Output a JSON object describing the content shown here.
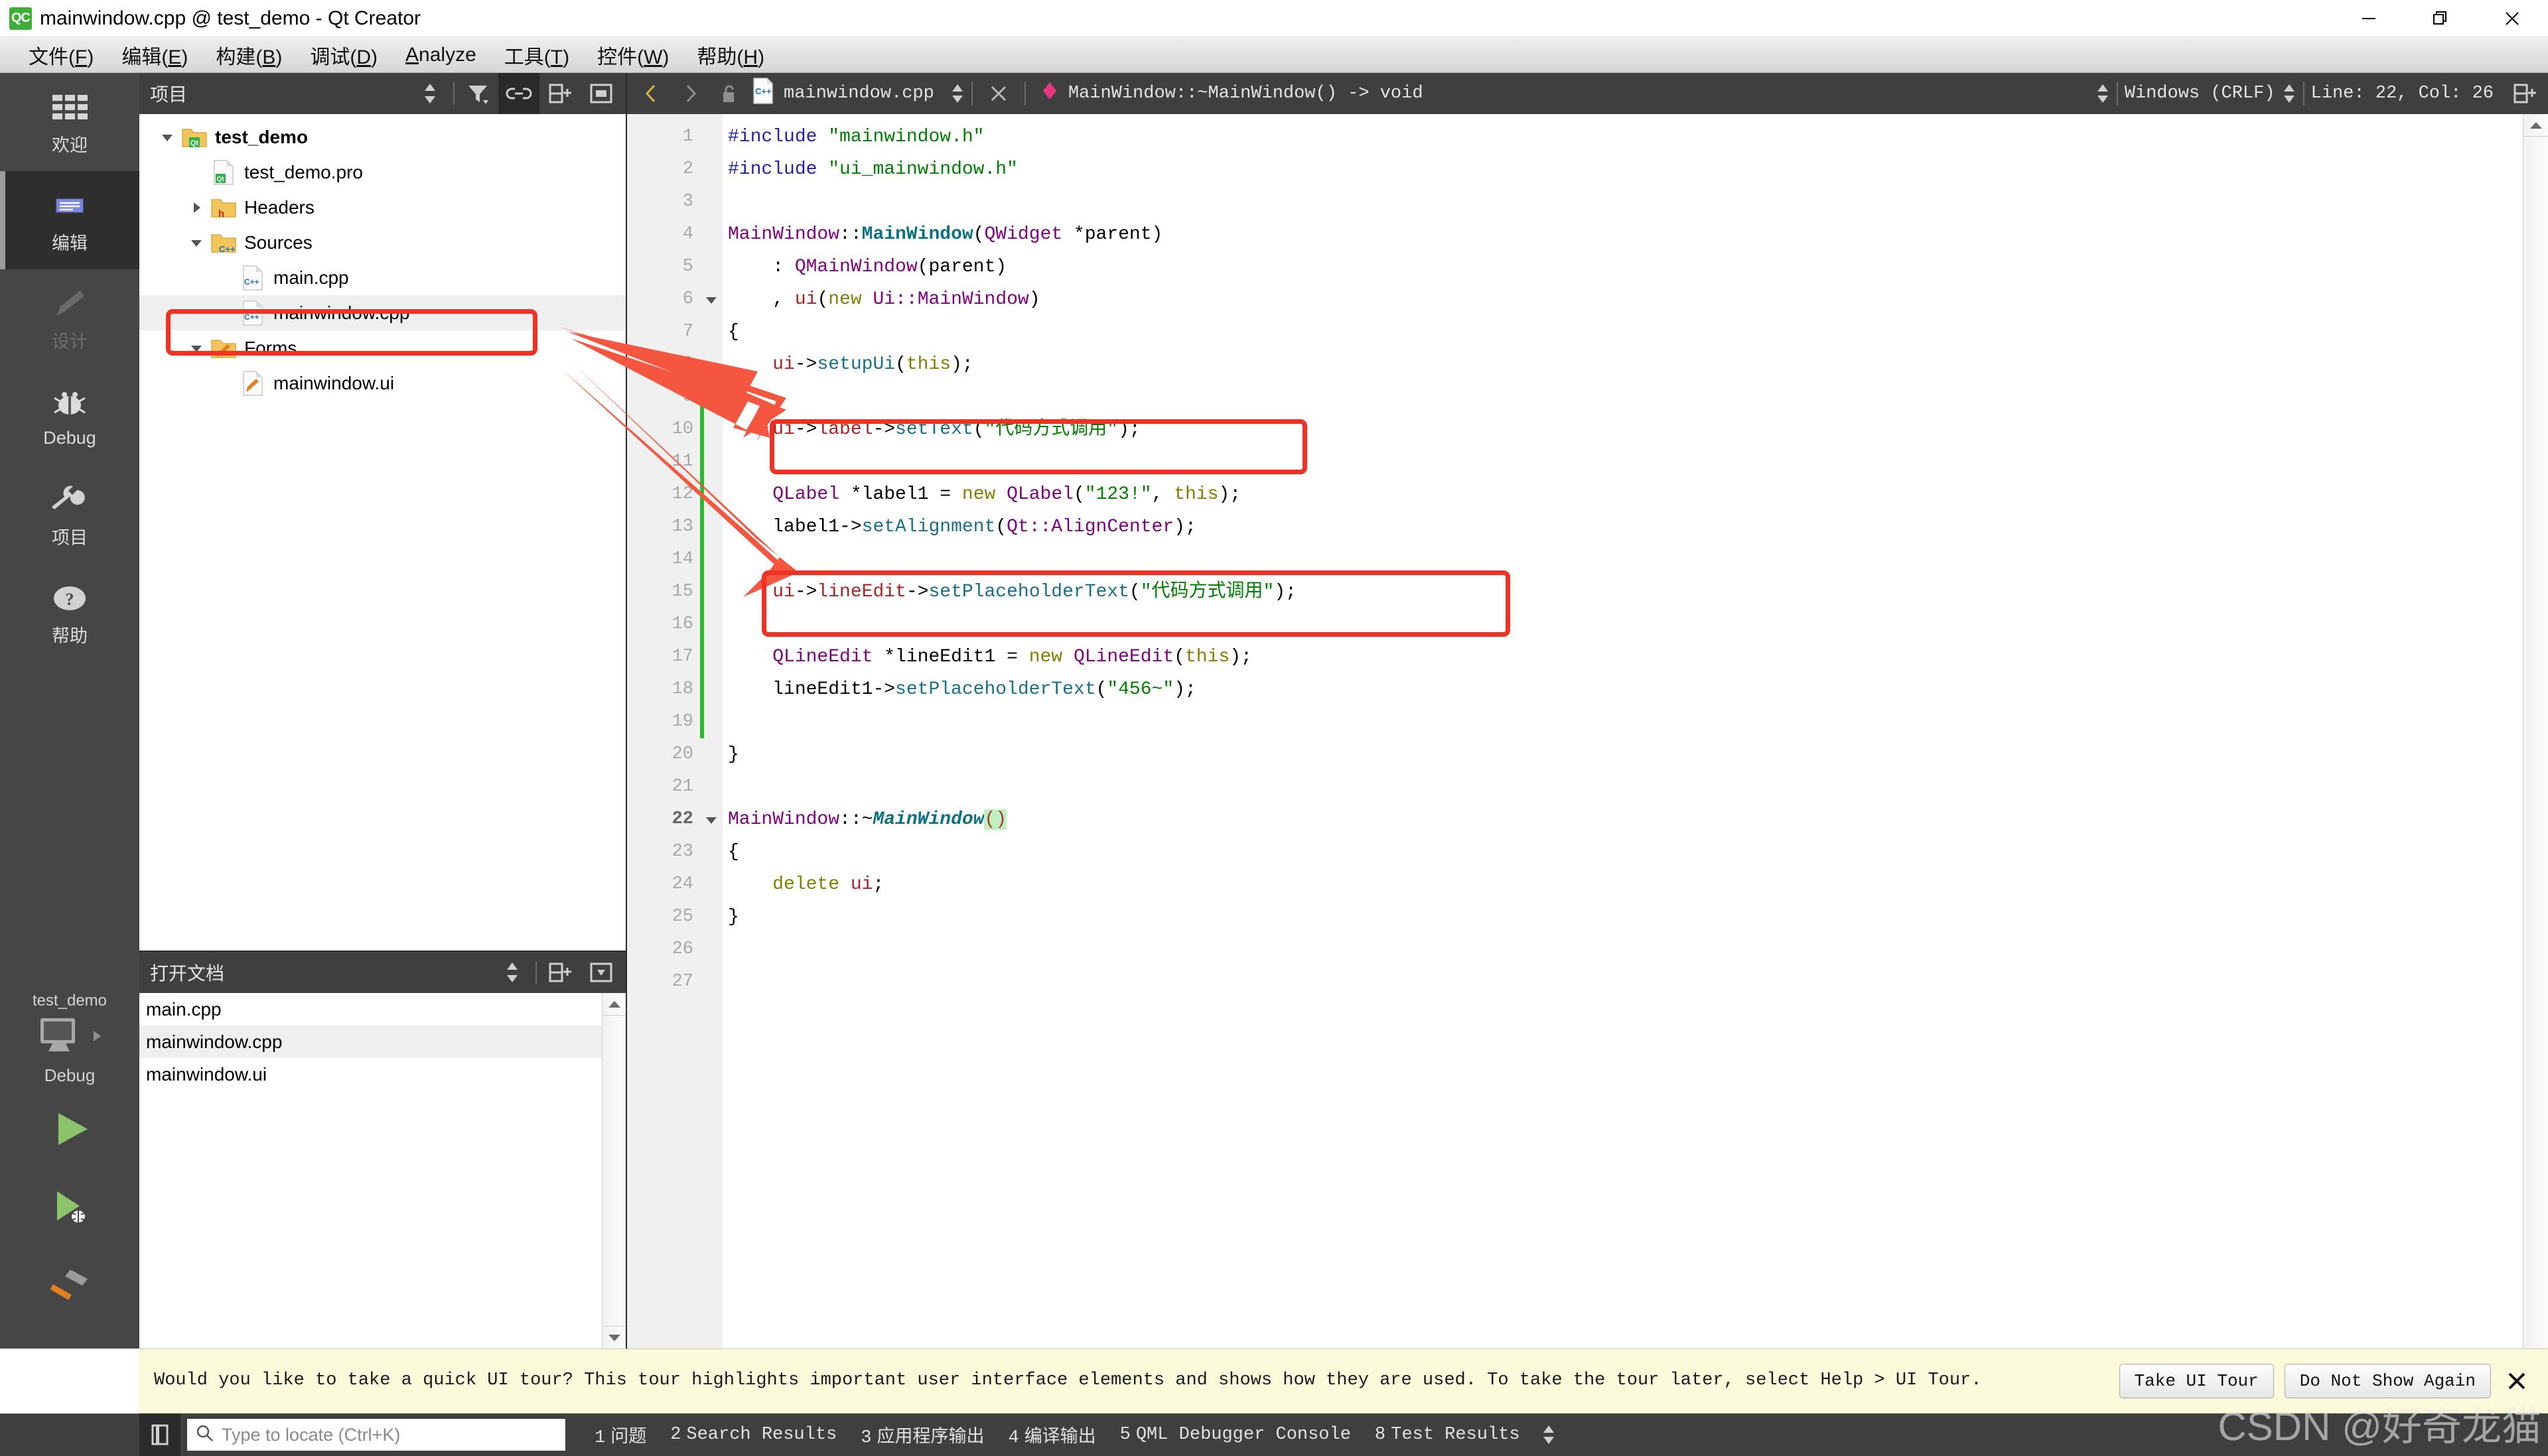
{
  "window": {
    "title": "mainwindow.cpp @ test_demo - Qt Creator",
    "logo_text": "QC",
    "minimize_label": "—",
    "maximize_label": "❐",
    "close_label": "✕"
  },
  "menubar": {
    "items": [
      {
        "name": "file",
        "pre": "文件(",
        "key": "F",
        "post": ")"
      },
      {
        "name": "edit",
        "pre": "编辑(",
        "key": "E",
        "post": ")"
      },
      {
        "name": "build",
        "pre": "构建(",
        "key": "B",
        "post": ")"
      },
      {
        "name": "debug",
        "pre": "调试(",
        "key": "D",
        "post": ")"
      },
      {
        "name": "analyze",
        "pre": "",
        "key": "A",
        "post": "nalyze"
      },
      {
        "name": "tools",
        "pre": "工具(",
        "key": "T",
        "post": ")"
      },
      {
        "name": "widgets",
        "pre": "控件(",
        "key": "W",
        "post": ")"
      },
      {
        "name": "help",
        "pre": "帮助(",
        "key": "H",
        "post": ")"
      }
    ]
  },
  "modebar": {
    "modes": [
      {
        "id": "welcome",
        "label": "欢迎",
        "icon": "grid-icon",
        "state": "normal"
      },
      {
        "id": "edit",
        "label": "编辑",
        "icon": "edit-icon",
        "state": "active"
      },
      {
        "id": "design",
        "label": "设计",
        "icon": "pencil-icon",
        "state": "disabled"
      },
      {
        "id": "debug",
        "label": "Debug",
        "icon": "bug-icon",
        "state": "normal"
      },
      {
        "id": "projects",
        "label": "项目",
        "icon": "wrench-icon",
        "state": "normal"
      },
      {
        "id": "help",
        "label": "帮助",
        "icon": "question-icon",
        "state": "normal"
      }
    ],
    "kit": {
      "project": "test_demo",
      "build_config": "Debug",
      "target_icon": "desktop-icon",
      "arrow_icon": "chevron-right-icon"
    },
    "actions": [
      {
        "id": "run",
        "icon": "run-icon"
      },
      {
        "id": "debug-run",
        "icon": "debug-run-icon"
      },
      {
        "id": "build",
        "icon": "hammer-icon"
      }
    ]
  },
  "project_panel": {
    "title": "项目",
    "tools": [
      {
        "id": "sync-selector",
        "icon": "updown-arrows-icon",
        "active": false
      },
      {
        "id": "filter",
        "icon": "filter-icon",
        "active": false
      },
      {
        "id": "link-editor",
        "icon": "link-icon",
        "active": true
      },
      {
        "id": "split",
        "icon": "split-add-icon",
        "active": false
      },
      {
        "id": "close-panel",
        "icon": "panel-close-icon",
        "active": false
      }
    ],
    "tree": [
      {
        "id": "test_demo",
        "label": "test_demo",
        "depth": 0,
        "arrow": "down",
        "icon": "qt-folder-icon",
        "bold": true,
        "selected": false
      },
      {
        "id": "test_demo_pro",
        "label": "test_demo.pro",
        "depth": 1,
        "arrow": "none",
        "icon": "qt-file-icon",
        "bold": false,
        "selected": false
      },
      {
        "id": "headers",
        "label": "Headers",
        "depth": 1,
        "arrow": "right",
        "icon": "h-folder-icon",
        "bold": false,
        "selected": false
      },
      {
        "id": "sources",
        "label": "Sources",
        "depth": 1,
        "arrow": "down",
        "icon": "cpp-folder-icon",
        "bold": false,
        "selected": false
      },
      {
        "id": "main_cpp",
        "label": "main.cpp",
        "depth": 2,
        "arrow": "none",
        "icon": "cpp-file-icon",
        "bold": false,
        "selected": false
      },
      {
        "id": "mainwindow_cpp",
        "label": "mainwindow.cpp",
        "depth": 2,
        "arrow": "none",
        "icon": "cpp-file-icon",
        "bold": false,
        "selected": true
      },
      {
        "id": "forms",
        "label": "Forms",
        "depth": 1,
        "arrow": "down",
        "icon": "ui-folder-icon",
        "bold": false,
        "selected": false
      },
      {
        "id": "mainwindow_ui",
        "label": "mainwindow.ui",
        "depth": 2,
        "arrow": "none",
        "icon": "ui-file-icon",
        "bold": false,
        "selected": false
      }
    ]
  },
  "open_documents": {
    "title": "打开文档",
    "tools": [
      {
        "id": "od-sync",
        "icon": "updown-arrows-icon"
      },
      {
        "id": "od-split",
        "icon": "split-add-icon"
      },
      {
        "id": "od-close",
        "icon": "panel-dropdown-icon"
      }
    ],
    "items": [
      {
        "id": "main_cpp",
        "label": "main.cpp",
        "selected": false
      },
      {
        "id": "mainwindow_cpp",
        "label": "mainwindow.cpp",
        "selected": true
      },
      {
        "id": "mainwindow_ui",
        "label": "mainwindow.ui",
        "selected": false
      }
    ]
  },
  "editor_toolbar": {
    "back_icon": "chevron-left-icon",
    "forward_icon": "chevron-right-icon",
    "lock_icon": "unlocked-icon",
    "file_icon": "cpp-file-icon",
    "filename": "mainwindow.cpp",
    "file_spin_icon": "updown-arrows-icon",
    "close_icon": "close-icon",
    "symbol_icon": "diamond-icon",
    "symbol": "MainWindow::~MainWindow() -> void",
    "symbol_spin_icon": "updown-arrows-icon",
    "line_ending": "Windows (CRLF)",
    "line_ending_spin_icon": "updown-arrows-icon",
    "cursor_pos": "Line: 22, Col: 26",
    "split_icon": "split-add-icon"
  },
  "editor": {
    "current_line": 22,
    "lines": [
      {
        "n": 1,
        "fold": "none",
        "changed": false,
        "tokens": [
          {
            "t": "#include ",
            "c": "k-pre"
          },
          {
            "t": "\"mainwindow.h\"",
            "c": "k-str"
          }
        ]
      },
      {
        "n": 2,
        "fold": "none",
        "changed": false,
        "tokens": [
          {
            "t": "#include ",
            "c": "k-pre"
          },
          {
            "t": "\"ui_mainwindow.h\"",
            "c": "k-str"
          }
        ]
      },
      {
        "n": 3,
        "fold": "none",
        "changed": false,
        "tokens": []
      },
      {
        "n": 4,
        "fold": "none",
        "changed": false,
        "tokens": [
          {
            "t": "MainWindow",
            "c": "k-type"
          },
          {
            "t": "::",
            "c": "k-op"
          },
          {
            "t": "MainWindow",
            "c": "k-fn"
          },
          {
            "t": "(",
            "c": "k-op"
          },
          {
            "t": "QWidget",
            "c": "k-type"
          },
          {
            "t": " *parent)",
            "c": "k-op"
          }
        ]
      },
      {
        "n": 5,
        "fold": "none",
        "changed": false,
        "tokens": [
          {
            "t": "    : ",
            "c": "k-op"
          },
          {
            "t": "QMainWindow",
            "c": "k-type"
          },
          {
            "t": "(parent)",
            "c": "k-op"
          }
        ]
      },
      {
        "n": 6,
        "fold": "down",
        "changed": false,
        "tokens": [
          {
            "t": "    , ",
            "c": "k-op"
          },
          {
            "t": "ui",
            "c": "k-fld"
          },
          {
            "t": "(",
            "c": "k-op"
          },
          {
            "t": "new",
            "c": "k-kw"
          },
          {
            "t": " ",
            "c": "k-op"
          },
          {
            "t": "Ui::MainWindow",
            "c": "k-type"
          },
          {
            "t": ")",
            "c": "k-op"
          }
        ]
      },
      {
        "n": 7,
        "fold": "none",
        "changed": false,
        "tokens": [
          {
            "t": "{",
            "c": "k-op"
          }
        ]
      },
      {
        "n": 8,
        "fold": "none",
        "changed": false,
        "tokens": [
          {
            "t": "    ",
            "c": "k-op"
          },
          {
            "t": "ui",
            "c": "k-fld"
          },
          {
            "t": "->",
            "c": "k-op"
          },
          {
            "t": "setupUi",
            "c": "k-call"
          },
          {
            "t": "(",
            "c": "k-op"
          },
          {
            "t": "this",
            "c": "k-kw"
          },
          {
            "t": ");",
            "c": "k-op"
          }
        ]
      },
      {
        "n": 9,
        "fold": "none",
        "changed": true,
        "tokens": []
      },
      {
        "n": 10,
        "fold": "none",
        "changed": true,
        "tokens": [
          {
            "t": "    ",
            "c": "k-op"
          },
          {
            "t": "ui",
            "c": "k-fld"
          },
          {
            "t": "->",
            "c": "k-op"
          },
          {
            "t": "label",
            "c": "k-fld"
          },
          {
            "t": "->",
            "c": "k-op"
          },
          {
            "t": "setText",
            "c": "k-call"
          },
          {
            "t": "(",
            "c": "k-op"
          },
          {
            "t": "\"代码方式调用\"",
            "c": "k-str"
          },
          {
            "t": ");",
            "c": "k-op"
          }
        ]
      },
      {
        "n": 11,
        "fold": "none",
        "changed": true,
        "tokens": []
      },
      {
        "n": 12,
        "fold": "none",
        "changed": true,
        "tokens": [
          {
            "t": "    ",
            "c": "k-op"
          },
          {
            "t": "QLabel",
            "c": "k-type"
          },
          {
            "t": " *label1 = ",
            "c": "k-op"
          },
          {
            "t": "new",
            "c": "k-kw"
          },
          {
            "t": " ",
            "c": "k-op"
          },
          {
            "t": "QLabel",
            "c": "k-type"
          },
          {
            "t": "(",
            "c": "k-op"
          },
          {
            "t": "\"123!\"",
            "c": "k-str"
          },
          {
            "t": ", ",
            "c": "k-op"
          },
          {
            "t": "this",
            "c": "k-kw"
          },
          {
            "t": ");",
            "c": "k-op"
          }
        ]
      },
      {
        "n": 13,
        "fold": "none",
        "changed": true,
        "tokens": [
          {
            "t": "    label1",
            "c": "k-op"
          },
          {
            "t": "->",
            "c": "k-op"
          },
          {
            "t": "setAlignment",
            "c": "k-call"
          },
          {
            "t": "(",
            "c": "k-op"
          },
          {
            "t": "Qt::AlignCenter",
            "c": "k-type"
          },
          {
            "t": ");",
            "c": "k-op"
          }
        ]
      },
      {
        "n": 14,
        "fold": "none",
        "changed": true,
        "tokens": []
      },
      {
        "n": 15,
        "fold": "none",
        "changed": true,
        "tokens": [
          {
            "t": "    ",
            "c": "k-op"
          },
          {
            "t": "ui",
            "c": "k-fld"
          },
          {
            "t": "->",
            "c": "k-op"
          },
          {
            "t": "lineEdit",
            "c": "k-fld"
          },
          {
            "t": "->",
            "c": "k-op"
          },
          {
            "t": "setPlaceholderText",
            "c": "k-call"
          },
          {
            "t": "(",
            "c": "k-op"
          },
          {
            "t": "\"代码方式调用\"",
            "c": "k-str"
          },
          {
            "t": ");",
            "c": "k-op"
          }
        ]
      },
      {
        "n": 16,
        "fold": "none",
        "changed": true,
        "tokens": []
      },
      {
        "n": 17,
        "fold": "none",
        "changed": true,
        "tokens": [
          {
            "t": "    ",
            "c": "k-op"
          },
          {
            "t": "QLineEdit",
            "c": "k-type"
          },
          {
            "t": " *lineEdit1 = ",
            "c": "k-op"
          },
          {
            "t": "new",
            "c": "k-kw"
          },
          {
            "t": " ",
            "c": "k-op"
          },
          {
            "t": "QLineEdit",
            "c": "k-type"
          },
          {
            "t": "(",
            "c": "k-op"
          },
          {
            "t": "this",
            "c": "k-kw"
          },
          {
            "t": ");",
            "c": "k-op"
          }
        ]
      },
      {
        "n": 18,
        "fold": "none",
        "changed": true,
        "tokens": [
          {
            "t": "    lineEdit1",
            "c": "k-op"
          },
          {
            "t": "->",
            "c": "k-op"
          },
          {
            "t": "setPlaceholderText",
            "c": "k-call"
          },
          {
            "t": "(",
            "c": "k-op"
          },
          {
            "t": "\"456~\"",
            "c": "k-str"
          },
          {
            "t": ");",
            "c": "k-op"
          }
        ]
      },
      {
        "n": 19,
        "fold": "none",
        "changed": true,
        "tokens": []
      },
      {
        "n": 20,
        "fold": "none",
        "changed": false,
        "tokens": [
          {
            "t": "}",
            "c": "k-op"
          }
        ]
      },
      {
        "n": 21,
        "fold": "none",
        "changed": false,
        "tokens": []
      },
      {
        "n": 22,
        "fold": "down",
        "changed": false,
        "tokens": [
          {
            "t": "MainWindow",
            "c": "k-type"
          },
          {
            "t": "::~",
            "c": "k-op"
          },
          {
            "t": "MainWindow",
            "c": "k-dtor"
          },
          {
            "t": "()",
            "c": "k-var paren-hl"
          }
        ]
      },
      {
        "n": 23,
        "fold": "none",
        "changed": false,
        "tokens": [
          {
            "t": "{",
            "c": "k-op"
          }
        ]
      },
      {
        "n": 24,
        "fold": "none",
        "changed": false,
        "tokens": [
          {
            "t": "    ",
            "c": "k-op"
          },
          {
            "t": "delete",
            "c": "k-kw"
          },
          {
            "t": " ",
            "c": "k-op"
          },
          {
            "t": "ui",
            "c": "k-fld"
          },
          {
            "t": ";",
            "c": "k-op"
          }
        ]
      },
      {
        "n": 25,
        "fold": "none",
        "changed": false,
        "tokens": [
          {
            "t": "}",
            "c": "k-op"
          }
        ]
      },
      {
        "n": 26,
        "fold": "none",
        "changed": false,
        "tokens": []
      },
      {
        "n": 27,
        "fold": "none",
        "changed": false,
        "tokens": []
      }
    ]
  },
  "notification": {
    "message": "Would you like to take a quick UI tour? This tour highlights important user interface elements and shows how they are used. To take the tour later, select Help > UI Tour.",
    "primary_button": "Take UI Tour",
    "secondary_button": "Do Not Show Again",
    "close_icon": "close-icon"
  },
  "statusbar": {
    "sidebar_toggle_icon": "sidebar-toggle-icon",
    "locator_icon": "search-icon",
    "locator_placeholder": "Type to locate (Ctrl+K)",
    "tabs": [
      {
        "num": "1",
        "label": "问题"
      },
      {
        "num": "2",
        "label": "Search Results"
      },
      {
        "num": "3",
        "label": "应用程序输出"
      },
      {
        "num": "4",
        "label": "编译输出"
      },
      {
        "num": "5",
        "label": "QML Debugger Console"
      },
      {
        "num": "8",
        "label": "Test Results"
      }
    ],
    "spin_icon": "updown-arrows-icon"
  },
  "watermark": "CSDN @好奇龙猫",
  "annotations": {
    "accent_color": "#ee3224",
    "boxes": [
      {
        "id": "tree-mainwindow-cpp-highlight"
      },
      {
        "id": "code-label-settext-highlight"
      },
      {
        "id": "code-lineedit-placeholder-highlight"
      }
    ],
    "arrows": [
      {
        "id": "arrow-to-settext"
      },
      {
        "id": "arrow-to-placeholder"
      }
    ]
  }
}
